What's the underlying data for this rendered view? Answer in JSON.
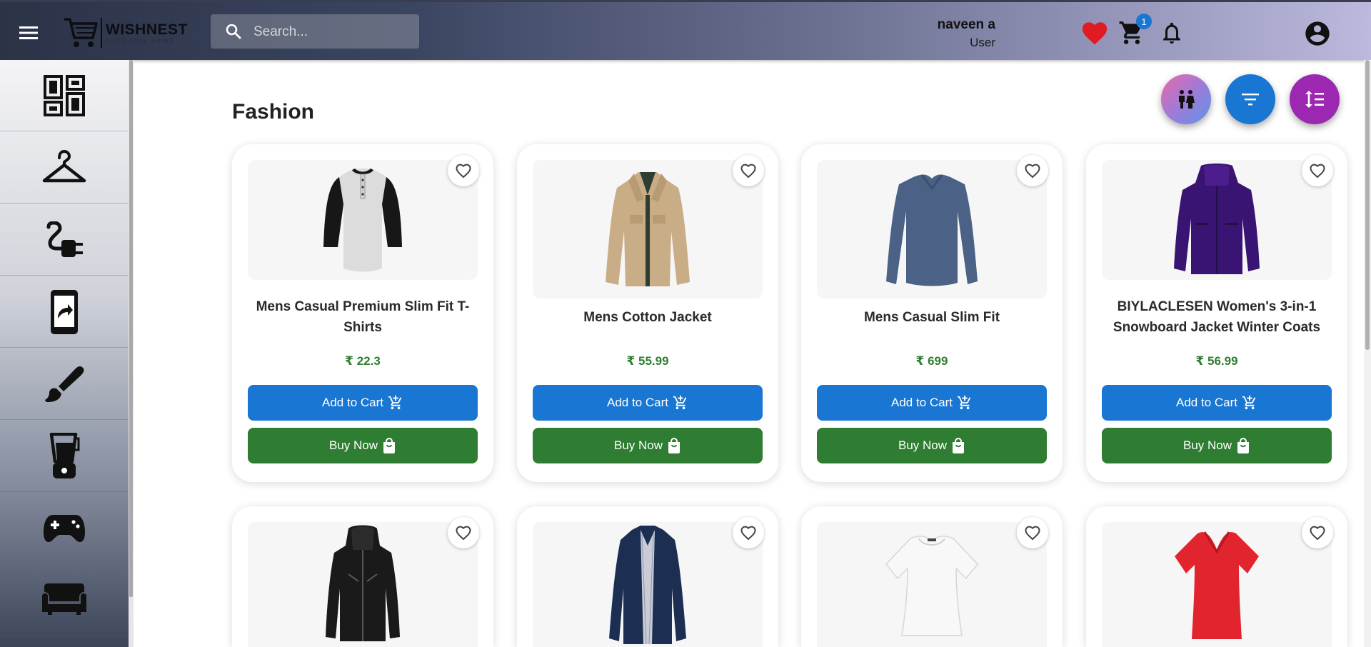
{
  "header": {
    "logo_name": "WISHNEST",
    "logo_tagline": "SHOP SAVE SHINE",
    "search_placeholder": "Search...",
    "cart_count": "1",
    "user_name": "naveen a",
    "user_role": "User"
  },
  "sidebar": {
    "items": [
      {
        "icon": "dashboard-icon"
      },
      {
        "icon": "hanger-icon"
      },
      {
        "icon": "electronics-plug-icon"
      },
      {
        "icon": "mobile-share-icon"
      },
      {
        "icon": "brush-icon"
      },
      {
        "icon": "blender-icon"
      },
      {
        "icon": "gamepad-icon"
      },
      {
        "icon": "sofa-icon"
      }
    ]
  },
  "page": {
    "title": "Fashion"
  },
  "fabs": {
    "gender_filter": {
      "icon": "people-icon",
      "color": "#8e7fd6"
    },
    "filter": {
      "icon": "filter-list-icon",
      "color": "#1976d2"
    },
    "sort": {
      "icon": "sort-icon",
      "color": "#9c27b0"
    }
  },
  "buttons": {
    "add_to_cart": "Add to Cart",
    "buy_now": "Buy Now"
  },
  "products": [
    {
      "title": "Mens Casual Premium Slim Fit T-Shirts",
      "price": "₹ 22.3",
      "image": "raglan-tshirt"
    },
    {
      "title": "Mens Cotton Jacket",
      "price": "₹ 55.99",
      "image": "tan-jacket"
    },
    {
      "title": "Mens Casual Slim Fit",
      "price": "₹ 699",
      "image": "blue-longsleeve"
    },
    {
      "title": "BIYLACLESEN Women's 3-in-1 Snowboard Jacket Winter Coats",
      "price": "₹ 56.99",
      "image": "purple-jacket"
    },
    {
      "title": "",
      "price": "",
      "image": "black-leather-jacket"
    },
    {
      "title": "",
      "price": "",
      "image": "navy-raincoat"
    },
    {
      "title": "",
      "price": "",
      "image": "white-top"
    },
    {
      "title": "",
      "price": "",
      "image": "red-vneck"
    }
  ],
  "colors": {
    "cart_button": "#1976d2",
    "buy_button": "#2e7d32",
    "price": "#2e7d32",
    "heart": "#e01b22"
  }
}
